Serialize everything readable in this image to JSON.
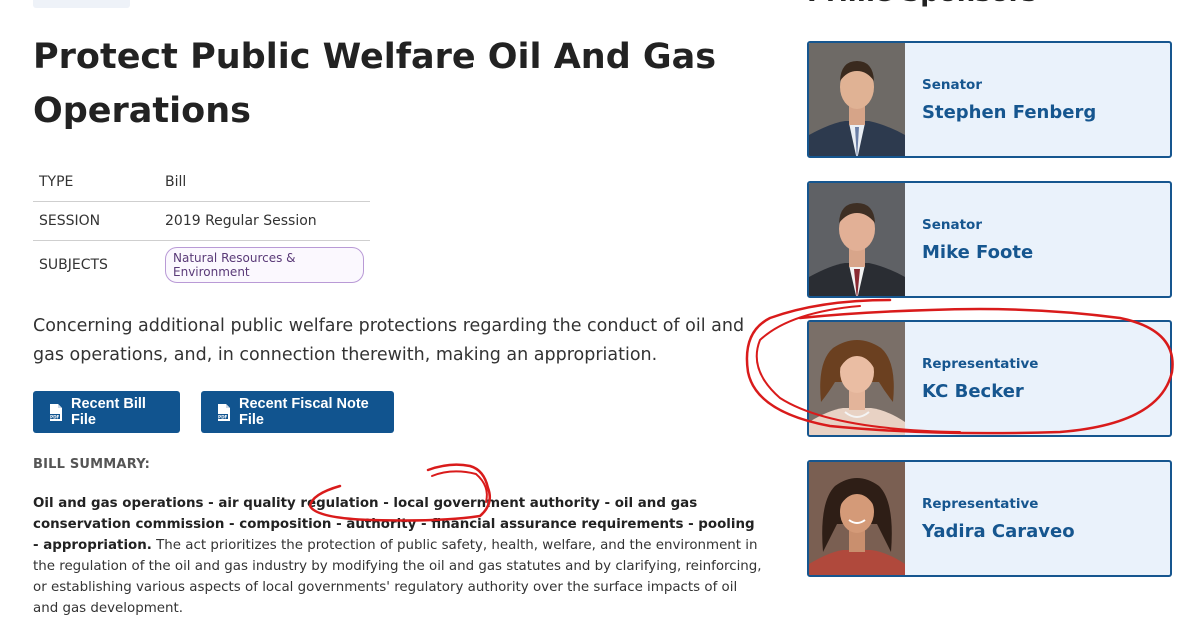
{
  "bill": {
    "title": "Protect Public Welfare Oil And Gas Operations",
    "meta": {
      "type_label": "TYPE",
      "type_value": "Bill",
      "session_label": "SESSION",
      "session_value": "2019 Regular Session",
      "subjects_label": "SUBJECTS",
      "subject_tag": "Natural Resources & Environment"
    },
    "concerning": "Concerning additional public welfare protections regarding the conduct of oil and gas operations, and, in connection therewith, making an appropriation.",
    "buttons": {
      "bill_file": "Recent Bill File",
      "fiscal_note": "Recent Fiscal Note File"
    },
    "summary": {
      "label": "BILL SUMMARY:",
      "bold_part": "Oil and gas operations - air quality regulation - local government authority - oil and gas conservation commission - composition - authority - financial assurance requirements - pooling - appropriation.",
      "body": " The act prioritizes the protection of public safety, health, welfare, and the environment in the regulation of the oil and gas industry by modifying the oil and gas statutes and by clarifying, reinforcing, or establishing various aspects of local governments' regulatory authority over the surface impacts of oil and gas development."
    }
  },
  "sponsors": {
    "heading": "Prime Sponsors",
    "list": [
      {
        "role": "Senator",
        "name": "Stephen Fenberg"
      },
      {
        "role": "Senator",
        "name": "Mike Foote"
      },
      {
        "role": "Representative",
        "name": "KC Becker"
      },
      {
        "role": "Representative",
        "name": "Yadira Caraveo"
      }
    ]
  },
  "colors": {
    "accent": "#16568f",
    "button": "#11548f",
    "card_bg": "#eaf2fb",
    "annotation": "#d91b1b"
  },
  "icons": {
    "file_icon": "pdf-file-icon"
  }
}
